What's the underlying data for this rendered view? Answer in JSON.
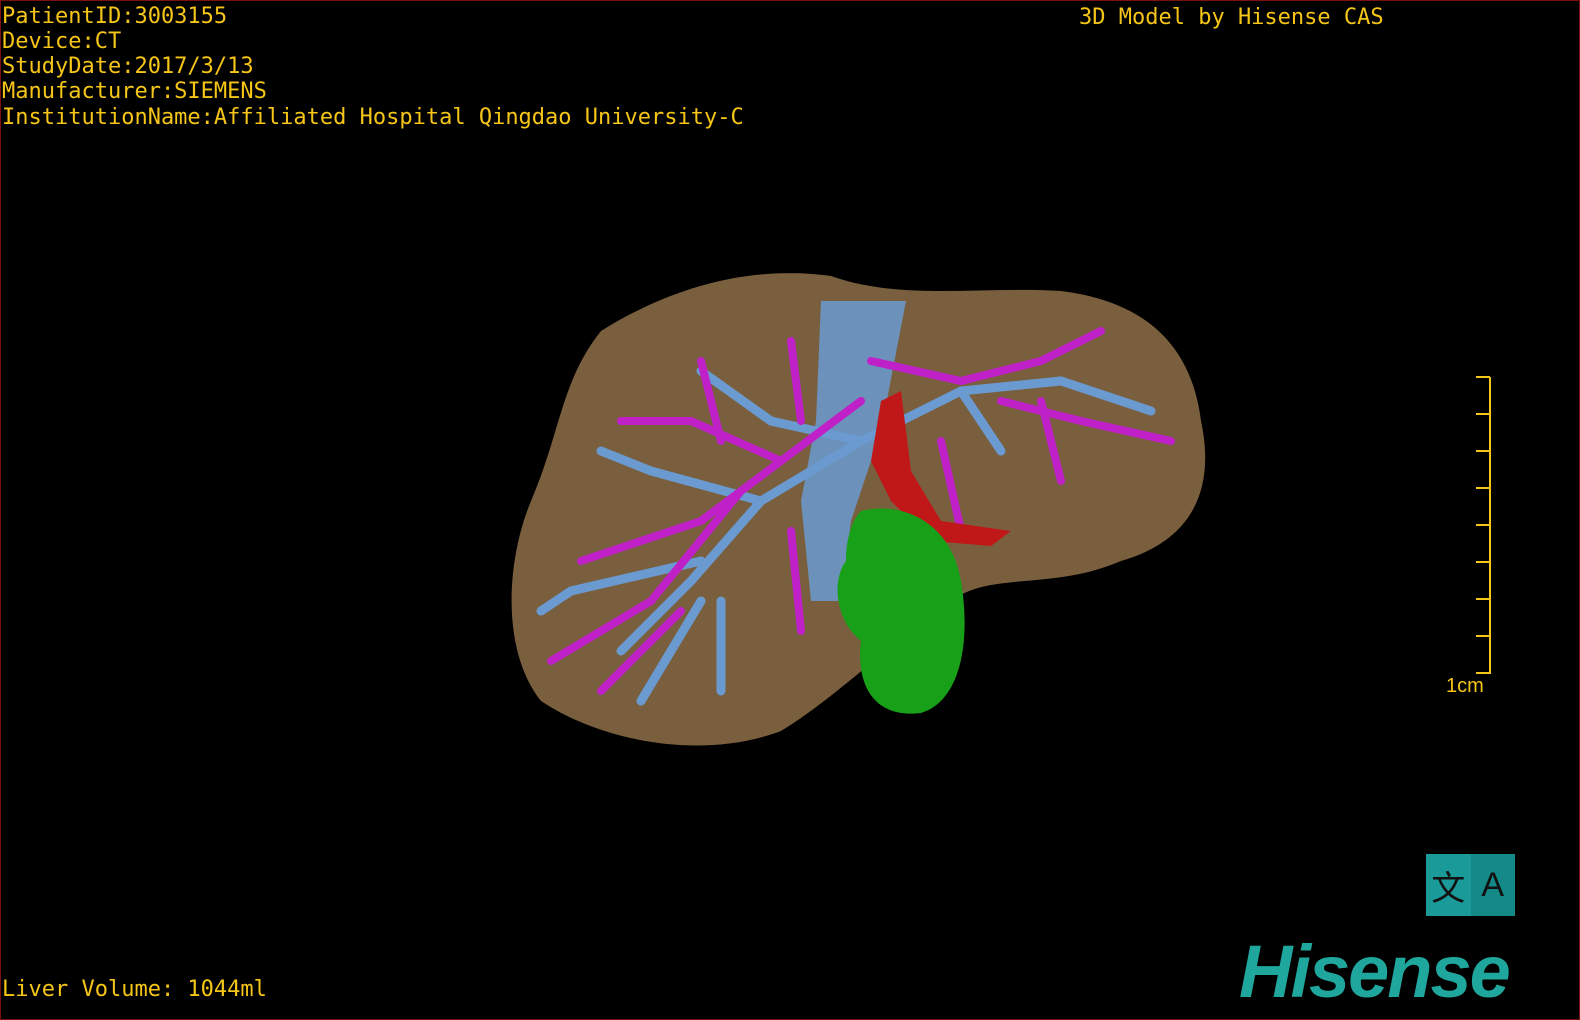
{
  "overlay": {
    "patient_id": "PatientID:3003155",
    "device": "Device:CT",
    "study_date": "StudyDate:2017/3/13",
    "manufacturer": "Manufacturer:SIEMENS",
    "institution": "InstitutionName:Affiliated Hospital Qingdao University-C",
    "title": "3D Model by Hisense CAS",
    "liver_volume": "Liver Volume: 1044ml"
  },
  "scale_bar": {
    "label": "1cm",
    "ticks": 9
  },
  "language_toggle": {
    "left": "文",
    "right": "A"
  },
  "logo": "Hisense",
  "colors": {
    "text": "#f5c518",
    "liver": "#7a5f3e",
    "hepatic_vein": "#c020c8",
    "portal_vein": "#6a9ad0",
    "artery": "#c01818",
    "gallbladder": "#18a018",
    "logo": "#1fa79d"
  }
}
